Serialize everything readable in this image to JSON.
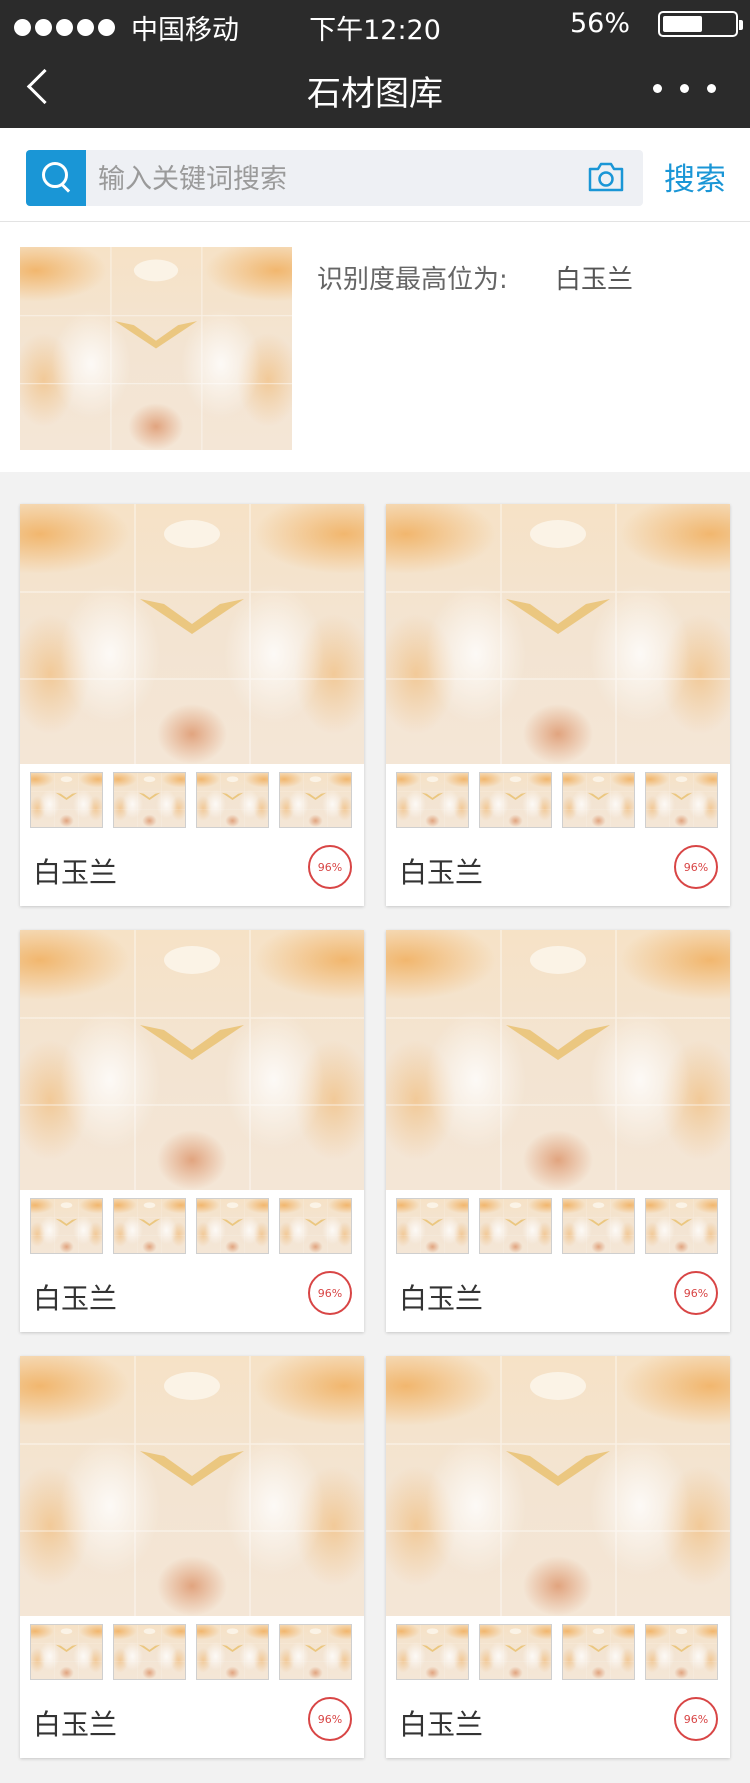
{
  "status_bar": {
    "carrier": "中国移动",
    "time": "下午12:20",
    "battery": "56%",
    "battery_level": 0.56
  },
  "nav": {
    "title": "石材图库"
  },
  "search": {
    "placeholder": "输入关键词搜索",
    "button_label": "搜索"
  },
  "result": {
    "label": "识别度最高位为:",
    "value": "白玉兰"
  },
  "cards": [
    {
      "name": "白玉兰",
      "score": "96%"
    },
    {
      "name": "白玉兰",
      "score": "96%"
    },
    {
      "name": "白玉兰",
      "score": "96%"
    },
    {
      "name": "白玉兰",
      "score": "96%"
    },
    {
      "name": "白玉兰",
      "score": "96%"
    },
    {
      "name": "白玉兰",
      "score": "96%"
    }
  ],
  "colors": {
    "accent": "#1a96d6",
    "header_bg": "#2b2b2b",
    "badge": "#d84545"
  }
}
